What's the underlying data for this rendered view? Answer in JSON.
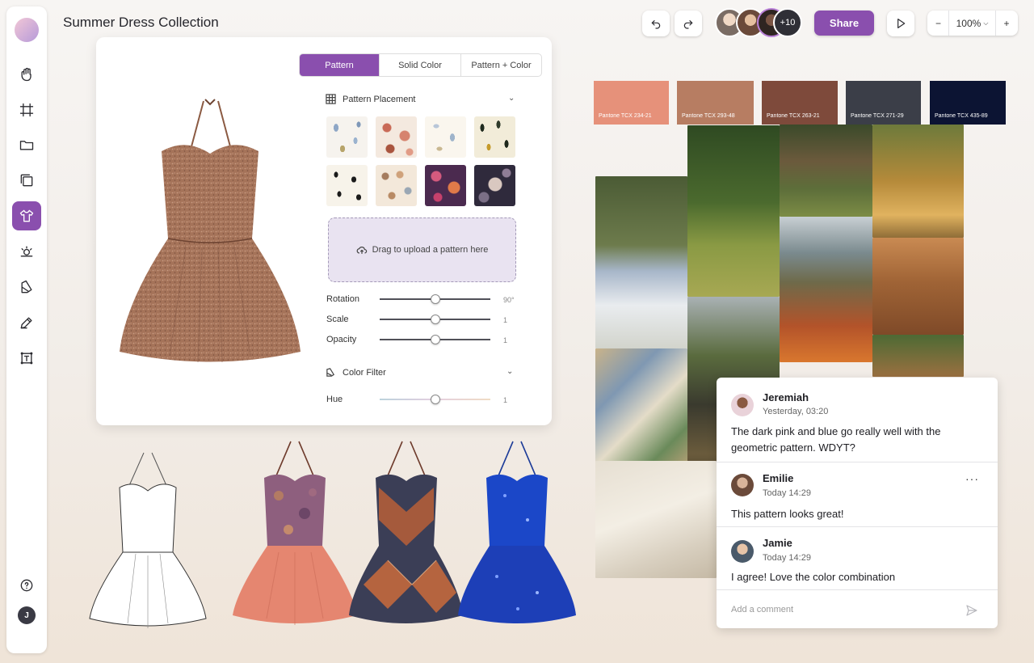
{
  "document": {
    "title": "Summer Dress Collection"
  },
  "header": {
    "share_label": "Share",
    "collaborators_more": "+10",
    "zoom_level": "100%",
    "zoom_minus": "−",
    "zoom_plus": "+"
  },
  "editor": {
    "tabs": [
      {
        "label": "Pattern",
        "active": true
      },
      {
        "label": "Solid Color",
        "active": false
      },
      {
        "label": "Pattern + Color",
        "active": false
      }
    ],
    "pattern_placement": {
      "title": "Pattern Placement"
    },
    "upload_label": "Drag to upload a pattern here",
    "sliders": [
      {
        "label": "Rotation",
        "value": "90°",
        "fraction": 0.5
      },
      {
        "label": "Scale",
        "value": "1",
        "fraction": 0.5
      },
      {
        "label": "Opacity",
        "value": "1",
        "fraction": 0.5
      }
    ],
    "color_filter": {
      "title": "Color Filter"
    },
    "hue": {
      "label": "Hue",
      "value": "1",
      "fraction": 0.5
    }
  },
  "moodboard": {
    "pantones": [
      {
        "label": "Pantone TCX 234-21",
        "color": "#e6917a"
      },
      {
        "label": "Pantone TCX 293-48",
        "color": "#b77d62"
      },
      {
        "label": "Pantone TCX 263-21",
        "color": "#7e4a3b"
      },
      {
        "label": "Pantone TCX 271-29",
        "color": "#3b3e48"
      },
      {
        "label": "Pantone TCX 435-89",
        "color": "#0c1433"
      }
    ]
  },
  "comments": {
    "items": [
      {
        "name": "Jeremiah",
        "time": "Yesterday, 03:20",
        "text": "The dark pink and blue go really well with the geometric pattern. WDYT?"
      },
      {
        "name": "Emilie",
        "time": "Today 14:29",
        "text": "This pattern looks great!"
      },
      {
        "name": "Jamie",
        "time": "Today 14:29",
        "text": "I agree! Love the color combination"
      }
    ],
    "more_label": "···",
    "placeholder": "Add a comment"
  },
  "user": {
    "initial": "J"
  }
}
